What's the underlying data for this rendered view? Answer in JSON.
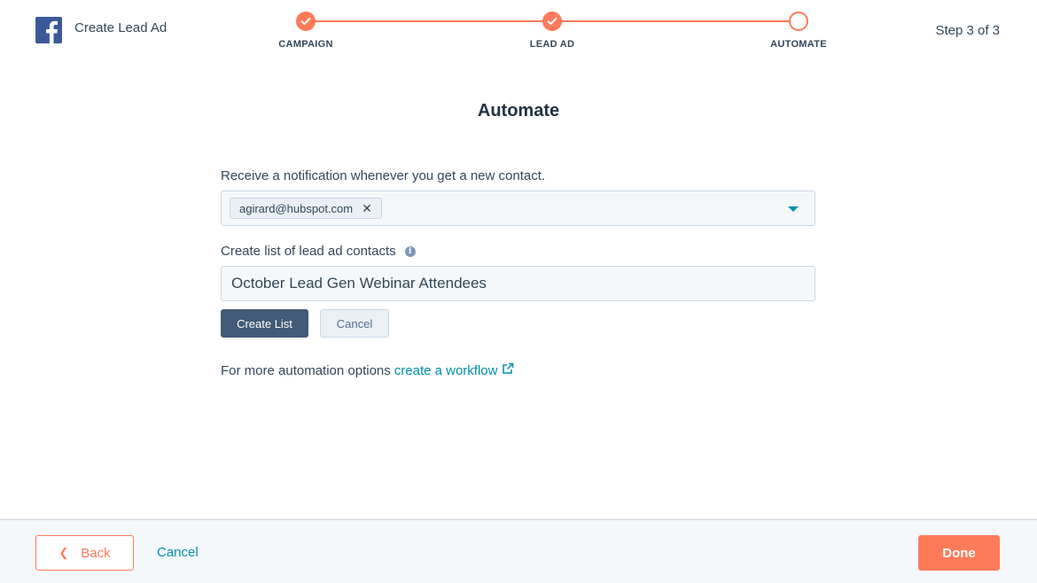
{
  "header": {
    "app_title": "Create Lead Ad",
    "step_count": "Step 3 of 3",
    "steps": [
      {
        "label": "CAMPAIGN",
        "status": "complete"
      },
      {
        "label": "LEAD AD",
        "status": "complete"
      },
      {
        "label": "AUTOMATE",
        "status": "current"
      }
    ]
  },
  "main": {
    "title": "Automate",
    "notification_label": "Receive a notification whenever you get a new contact.",
    "notification_recipients": [
      "agirard@hubspot.com"
    ],
    "list_label": "Create list of lead ad contacts",
    "list_name_value": "October Lead Gen Webinar Attendees",
    "create_list_label": "Create List",
    "cancel_label": "Cancel",
    "more_options_text": "For more automation options",
    "workflow_link_text": "create a workflow"
  },
  "footer": {
    "back_label": "Back",
    "cancel_label": "Cancel",
    "done_label": "Done"
  },
  "colors": {
    "accent": "#ff7a59",
    "link": "#0091ae",
    "primary_dark": "#425b76",
    "text": "#33475b",
    "facebook": "#3b5998"
  },
  "icons": {
    "logo": "facebook-icon",
    "step_complete": "checkmark-icon",
    "tag_remove": "close-icon",
    "dropdown": "caret-down-icon",
    "info": "info-icon",
    "external": "external-link-icon",
    "back": "chevron-left-icon"
  }
}
